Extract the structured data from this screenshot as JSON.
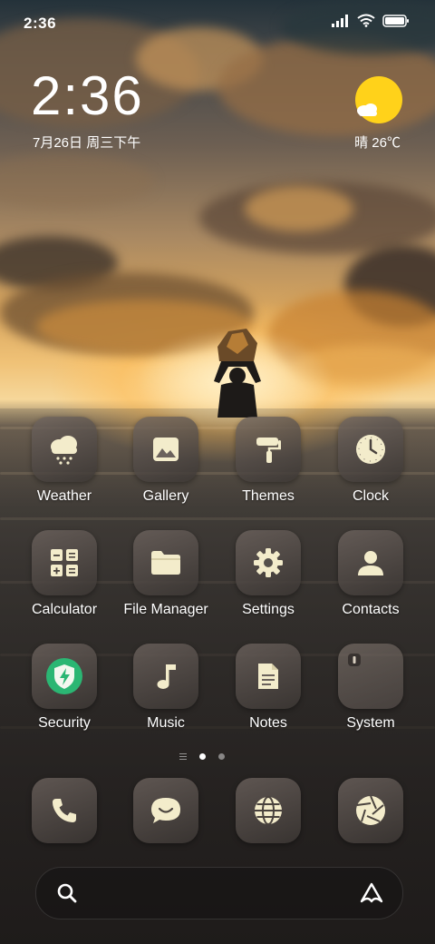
{
  "status_bar": {
    "time": "2:36"
  },
  "clock_widget": {
    "time": "2:36",
    "date": "7月26日 周三下午"
  },
  "weather_widget": {
    "text": "晴 26℃"
  },
  "apps": [
    {
      "label": "Weather",
      "icon": "weather-icon"
    },
    {
      "label": "Gallery",
      "icon": "gallery-icon"
    },
    {
      "label": "Themes",
      "icon": "themes-icon"
    },
    {
      "label": "Clock",
      "icon": "clock-icon"
    },
    {
      "label": "Calculator",
      "icon": "calculator-icon"
    },
    {
      "label": "File Manager",
      "icon": "folder-icon"
    },
    {
      "label": "Settings",
      "icon": "gear-icon"
    },
    {
      "label": "Contacts",
      "icon": "contact-icon"
    },
    {
      "label": "Security",
      "icon": "shield-icon"
    },
    {
      "label": "Music",
      "icon": "music-note-icon"
    },
    {
      "label": "Notes",
      "icon": "note-icon"
    },
    {
      "label": "System",
      "icon": "folder-icon"
    }
  ],
  "dock": [
    {
      "icon": "phone-icon"
    },
    {
      "icon": "message-icon"
    },
    {
      "icon": "browser-globe-icon"
    },
    {
      "icon": "camera-icon"
    }
  ],
  "page_indicator": {
    "pages": 2,
    "active": 1
  },
  "colors": {
    "icon_glyph": "#f3eccb",
    "weather_sun": "#ffd21a",
    "security_green": "#2bb673"
  }
}
